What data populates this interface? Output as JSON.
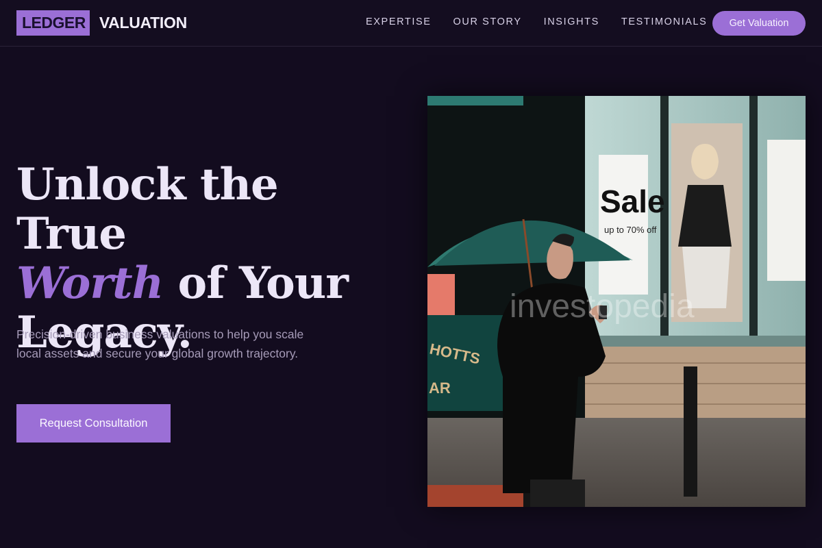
{
  "brand": {
    "logo_box": "LEDGER",
    "logo_rest": "VALUATION"
  },
  "nav": {
    "links": [
      "EXPERTISE",
      "OUR STORY",
      "INSIGHTS",
      "TESTIMONIALS"
    ],
    "cta": "Get Valuation"
  },
  "hero": {
    "title_line1": "Unlock the True",
    "title_accent": "Worth",
    "title_line2_rest": " of Your",
    "title_line3": "Legacy.",
    "subtitle": "Precision-driven business valuations to help you scale local assets and secure your global growth trajectory.",
    "cta": "Request Consultation"
  },
  "image": {
    "watermark": "investopedia",
    "sign_sale": "Sale",
    "sign_sale_sub": "up to 70% off",
    "shop_sign": "HOTTS",
    "shop_sign2": "AR"
  },
  "colors": {
    "background": "#130c1f",
    "accent": "#9b6fd6",
    "text": "#ece6f7",
    "muted": "#a69bb8"
  }
}
